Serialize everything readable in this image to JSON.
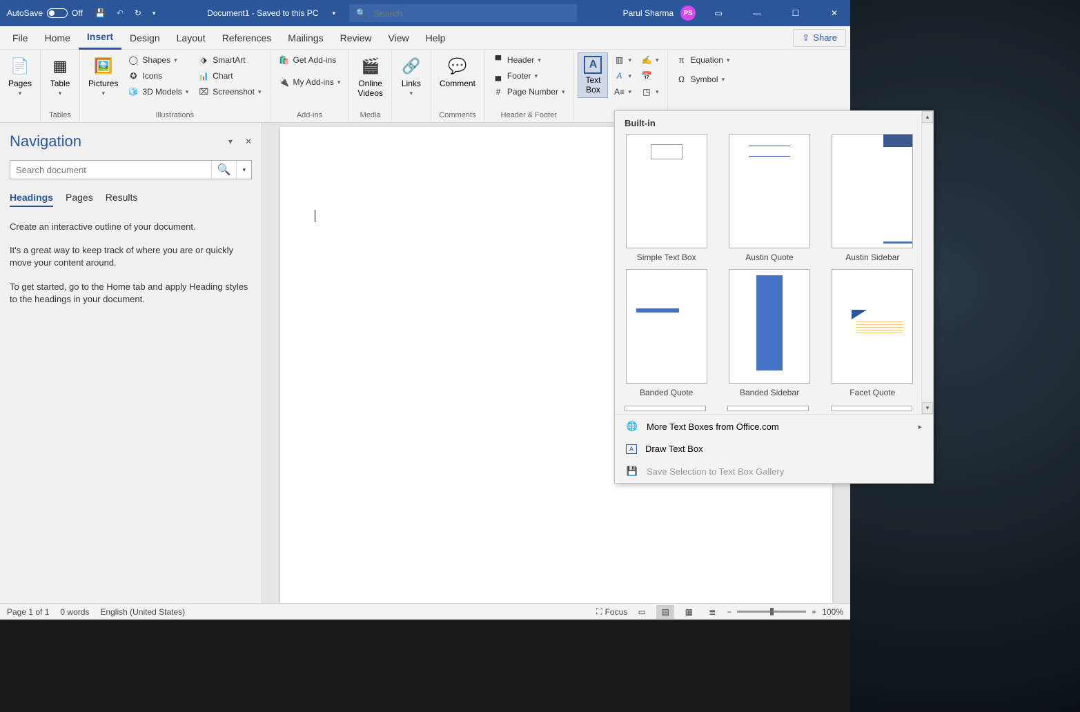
{
  "titlebar": {
    "autosave_label": "AutoSave",
    "autosave_state": "Off",
    "doc_title": "Document1 - Saved to this PC",
    "search_placeholder": "Search",
    "user_name": "Parul Sharma",
    "user_initials": "PS"
  },
  "tabs": {
    "file": "File",
    "home": "Home",
    "insert": "Insert",
    "design": "Design",
    "layout": "Layout",
    "references": "References",
    "mailings": "Mailings",
    "review": "Review",
    "view": "View",
    "help": "Help",
    "share": "Share"
  },
  "ribbon": {
    "pages": {
      "label": "Pages",
      "group": ""
    },
    "tables": {
      "table": "Table",
      "group": "Tables"
    },
    "illustrations": {
      "pictures": "Pictures",
      "shapes": "Shapes",
      "icons": "Icons",
      "models3d": "3D Models",
      "smartart": "SmartArt",
      "chart": "Chart",
      "screenshot": "Screenshot",
      "group": "Illustrations"
    },
    "addins": {
      "get": "Get Add-ins",
      "my": "My Add-ins",
      "group": "Add-ins"
    },
    "media": {
      "online_videos": "Online\nVideos",
      "group": "Media"
    },
    "links": {
      "links": "Links",
      "group": ""
    },
    "comments": {
      "comment": "Comment",
      "group": "Comments"
    },
    "header_footer": {
      "header": "Header",
      "footer": "Footer",
      "page_number": "Page Number",
      "group": "Header & Footer"
    },
    "text": {
      "textbox": "Text\nBox"
    },
    "symbols": {
      "equation": "Equation",
      "symbol": "Symbol"
    }
  },
  "nav": {
    "title": "Navigation",
    "search_placeholder": "Search document",
    "tabs": {
      "headings": "Headings",
      "pages": "Pages",
      "results": "Results"
    },
    "p1": "Create an interactive outline of your document.",
    "p2": "It's a great way to keep track of where you are or quickly move your content around.",
    "p3": "To get started, go to the Home tab and apply Heading styles to the headings in your document."
  },
  "gallery": {
    "section": "Built-in",
    "items": {
      "simple": "Simple Text Box",
      "austin_q": "Austin Quote",
      "austin_s": "Austin Sidebar",
      "banded_q": "Banded Quote",
      "banded_s": "Banded Sidebar",
      "facet_q": "Facet Quote"
    },
    "more_office": "More Text Boxes from Office.com",
    "draw": "Draw Text Box",
    "save_sel": "Save Selection to Text Box Gallery"
  },
  "status": {
    "page": "Page 1 of 1",
    "words": "0 words",
    "lang": "English (United States)",
    "focus": "Focus",
    "zoom": "100%"
  }
}
